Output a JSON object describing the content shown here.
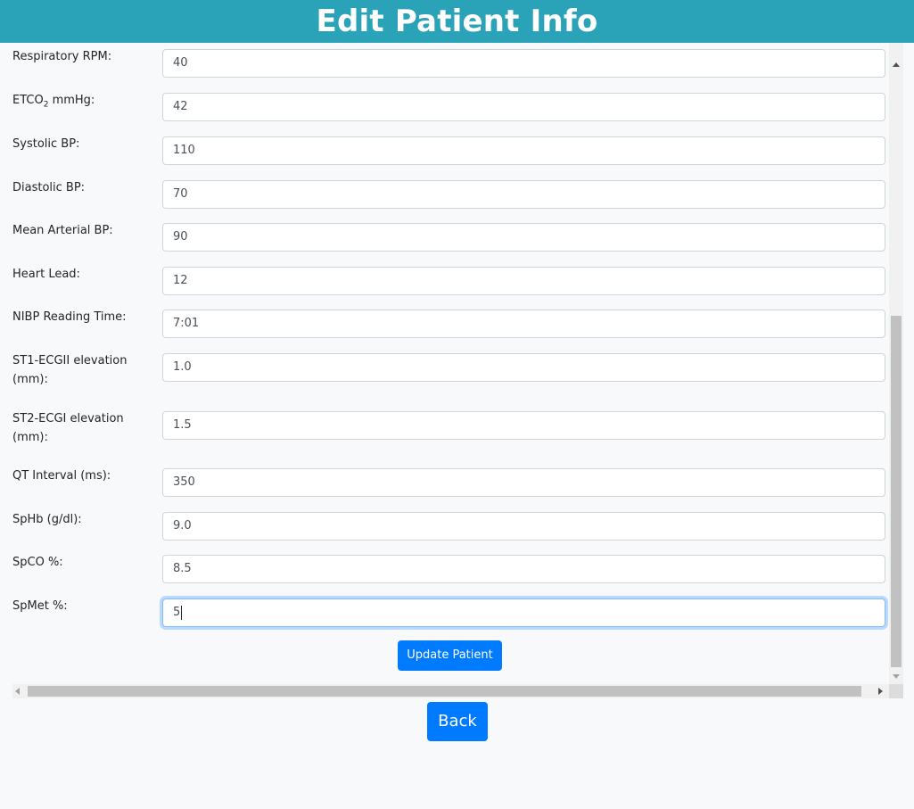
{
  "header": {
    "title": "Edit Patient Info"
  },
  "form": {
    "fields": [
      {
        "label": "Respiratory RPM:",
        "value": "40"
      },
      {
        "label_main": "ETCO",
        "label_sub": "2",
        "label_suffix": " mmHg:",
        "value": "42"
      },
      {
        "label": "Systolic BP:",
        "value": "110"
      },
      {
        "label": "Diastolic BP:",
        "value": "70"
      },
      {
        "label": "Mean Arterial BP:",
        "value": "90"
      },
      {
        "label": "Heart Lead:",
        "value": "12"
      },
      {
        "label": "NIBP Reading Time:",
        "value": "7:01"
      },
      {
        "label": "ST1-ECGII elevation (mm):",
        "value": "1.0"
      },
      {
        "label": "ST2-ECGI elevation (mm):",
        "value": "1.5"
      },
      {
        "label": "QT Interval (ms):",
        "value": "350"
      },
      {
        "label": "SpHb (g/dl):",
        "value": "9.0"
      },
      {
        "label": "SpCO %:",
        "value": "8.5"
      },
      {
        "label": "SpMet %:",
        "value": "5"
      }
    ],
    "submit_label": "Update Patient"
  },
  "back_label": "Back",
  "colors": {
    "header_bg": "#2aa3b8",
    "primary_button": "#007bff",
    "page_bg": "#f8f9fa"
  }
}
